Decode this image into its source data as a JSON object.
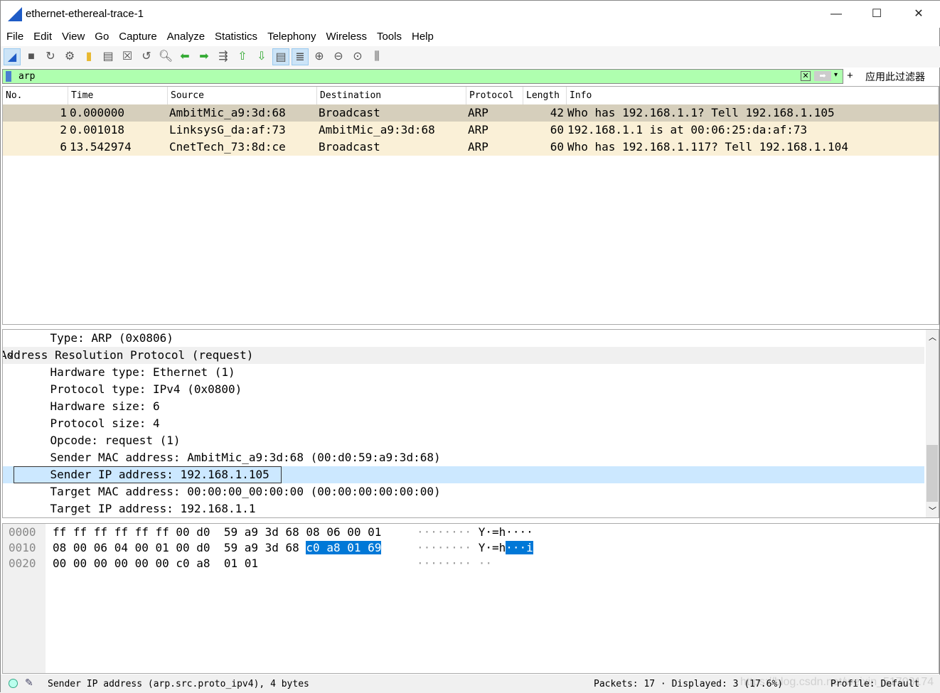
{
  "window": {
    "title": "ethernet-ethereal-trace-1",
    "minimize": "—",
    "maximize": "☐",
    "close": "✕"
  },
  "menu": [
    "File",
    "Edit",
    "View",
    "Go",
    "Capture",
    "Analyze",
    "Statistics",
    "Telephony",
    "Wireless",
    "Tools",
    "Help"
  ],
  "toolbar": [
    "start-capture",
    "stop-capture",
    "restart-capture",
    "capture-options",
    "open-file",
    "save-file",
    "close-file",
    "reload-file",
    "find-packet",
    "go-back",
    "go-forward",
    "go-to-packet",
    "go-first",
    "go-last",
    "auto-scroll",
    "colorize",
    "zoom-in",
    "zoom-out",
    "zoom-normal",
    "resize-columns"
  ],
  "filter": {
    "value": "arp",
    "apply_label": "应用此过滤器",
    "plus": "+"
  },
  "packet_list": {
    "columns": [
      "No.",
      "Time",
      "Source",
      "Destination",
      "Protocol",
      "Length",
      "Info"
    ],
    "rows": [
      [
        "1",
        "0.000000",
        "AmbitMic_a9:3d:68",
        "Broadcast",
        "ARP",
        "42",
        "Who has 192.168.1.1? Tell 192.168.1.105"
      ],
      [
        "2",
        "0.001018",
        "LinksysG_da:af:73",
        "AmbitMic_a9:3d:68",
        "ARP",
        "60",
        "192.168.1.1 is at 00:06:25:da:af:73"
      ],
      [
        "6",
        "13.542974",
        "CnetTech_73:8d:ce",
        "Broadcast",
        "ARP",
        "60",
        "Who has 192.168.1.117? Tell 192.168.1.104"
      ]
    ]
  },
  "details": {
    "rows": [
      "    Type: ARP (0x0806)",
      "Address Resolution Protocol (request)",
      "    Hardware type: Ethernet (1)",
      "    Protocol type: IPv4 (0x0800)",
      "    Hardware size: 6",
      "    Protocol size: 4",
      "    Opcode: request (1)",
      "    Sender MAC address: AmbitMic_a9:3d:68 (00:d0:59:a9:3d:68)",
      "    Sender IP address: 192.168.1.105",
      "    Target MAC address: 00:00:00_00:00:00 (00:00:00:00:00:00)",
      "    Target IP address: 192.168.1.1"
    ],
    "expander": "⌄"
  },
  "bytes": {
    "rows": [
      {
        "offset": "0000",
        "hex": "ff ff ff ff ff ff 00 d0  59 a9 3d 68 08 06 00 01",
        "hex_hl": "",
        "ascii_dots": "········ ",
        "ascii": "Y·=h····",
        "ascii_hl": ""
      },
      {
        "offset": "0010",
        "hex": "08 00 06 04 00 01 00 d0  59 a9 3d 68 ",
        "hex_hl": "c0 a8 01 69",
        "ascii_dots": "········ ",
        "ascii": "Y·=h",
        "ascii_hl": "···i"
      },
      {
        "offset": "0020",
        "hex": "00 00 00 00 00 00 c0 a8  01 01",
        "hex_hl": "",
        "ascii_dots": "········ ··",
        "ascii": "",
        "ascii_hl": ""
      }
    ]
  },
  "status": {
    "field": "Sender IP address (arp.src.proto_ipv4), 4 bytes",
    "packets": "Packets: 17 · Displayed: 3 (17.6%)",
    "profile": "Profile: Default",
    "watermark": "https://blog.csdn.net/weixin_51703174"
  }
}
